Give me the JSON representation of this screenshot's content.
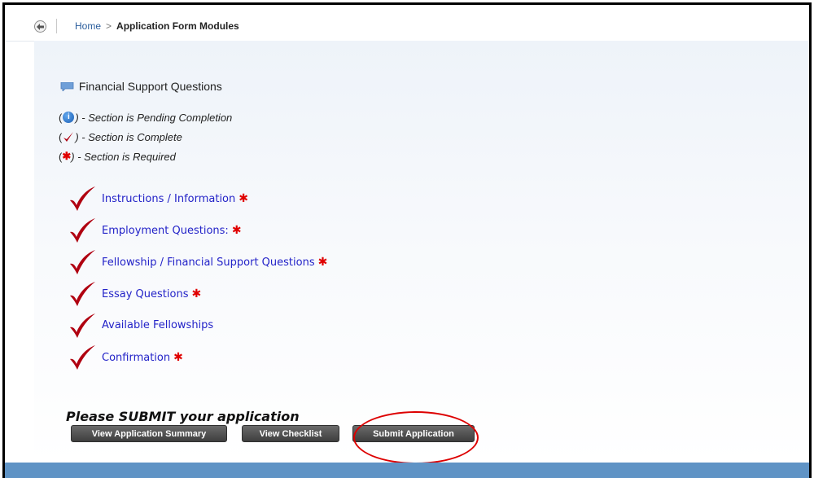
{
  "breadcrumb": {
    "home": "Home",
    "separator": ">",
    "current": "Application Form Modules"
  },
  "section": {
    "title": "Financial Support Questions",
    "icon": "speech-bubble-icon"
  },
  "legend": [
    {
      "symbol": "info-icon",
      "text": ") - Section is Pending Completion"
    },
    {
      "symbol": "checkmark-icon",
      "text": ") - Section is Complete"
    },
    {
      "symbol": "required-star",
      "text": ") - Section is Required"
    }
  ],
  "legend_open_paren": "(",
  "required_star": "✱",
  "info_glyph": "i",
  "modules": [
    {
      "label": "Instructions / Information",
      "required": true,
      "status": "complete"
    },
    {
      "label": "Employment Questions:",
      "required": true,
      "status": "complete"
    },
    {
      "label": "Fellowship / Financial Support Questions",
      "required": true,
      "status": "complete"
    },
    {
      "label": "Essay Questions",
      "required": true,
      "status": "complete"
    },
    {
      "label": "Available Fellowships",
      "required": false,
      "status": "complete"
    },
    {
      "label": "Confirmation",
      "required": true,
      "status": "complete"
    }
  ],
  "submit": {
    "heading": "Please SUBMIT your application",
    "buttons": {
      "summary": "View Application Summary",
      "checklist": "View Checklist",
      "submit": "Submit Application"
    }
  },
  "colors": {
    "link": "#2323c8",
    "required": "#e00000",
    "check": "#b00010",
    "annotation": "#dd0000",
    "bottom_bar": "#5f93c5"
  }
}
